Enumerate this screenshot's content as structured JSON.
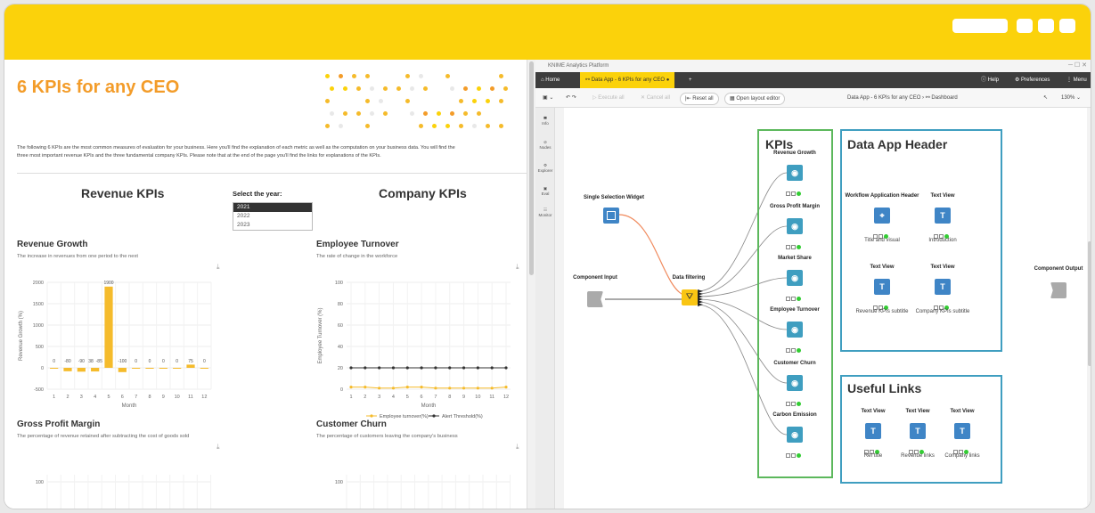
{
  "colors": {
    "accent_yellow": "#fbd20b",
    "title_orange": "#f39c29",
    "bar_yellow": "#f5bb2b",
    "line_black": "#333333",
    "green_box": "#5cb85c",
    "blue_box": "#3f9ec0"
  },
  "left": {
    "title": "6 KPIs for any CEO",
    "intro_line1": "The following 6 KPIs are the most common measures of evaluation for your business. Here you'll find the explanation of each metric as well as the computation on your business data. You will find the",
    "intro_line2": "three most important revenue KPIs and the three fundamental company KPIs. Please note that at the end of the page you'll find the links for explanations of the KPIs.",
    "revenue_heading": "Revenue KPIs",
    "company_heading": "Company KPIs",
    "year_label": "Select the year:",
    "years": [
      "2021",
      "2022",
      "2023"
    ],
    "charts": {
      "rev_growth": {
        "title": "Revenue Growth",
        "desc": "The increase in revenues from one period to the next"
      },
      "emp_turnover": {
        "title": "Employee Turnover",
        "desc": "The rate of change in the workforce"
      },
      "gross_margin": {
        "title": "Gross Profit Margin",
        "desc": "The percentage of revenue retained after subtracting the cost of goods sold"
      },
      "cust_churn": {
        "title": "Customer Churn",
        "desc": "The percentage of customers leaving the company's business"
      }
    }
  },
  "chart_data": [
    {
      "type": "bar",
      "title": "Revenue Growth",
      "xlabel": "Month",
      "ylabel": "Revenue Growth (%)",
      "categories": [
        "1",
        "2",
        "3",
        "4",
        "5",
        "6",
        "7",
        "8",
        "9",
        "10",
        "11",
        "12"
      ],
      "values": [
        0,
        -80,
        -90,
        -85,
        1900,
        -100,
        0,
        0,
        0,
        0,
        75,
        0
      ],
      "data_labels": [
        "0",
        "-80",
        "-90",
        "38",
        "-85",
        "1900",
        "-100",
        "0",
        "0",
        "0",
        "0",
        "75",
        "0"
      ],
      "ylim": [
        -500,
        2000
      ],
      "yticks": [
        "2000",
        "1500",
        "1000",
        "500",
        "0",
        "-500"
      ]
    },
    {
      "type": "line",
      "title": "Employee Turnover",
      "xlabel": "Month",
      "ylabel": "Employee Turnover (%)",
      "x": [
        "1",
        "2",
        "3",
        "4",
        "5",
        "6",
        "7",
        "8",
        "9",
        "10",
        "11",
        "12"
      ],
      "series": [
        {
          "name": "Employee turnover(%)",
          "values": [
            2,
            2,
            1,
            1,
            2,
            2,
            1,
            1,
            1,
            1,
            1,
            2
          ]
        },
        {
          "name": "Alert Threshold(%)",
          "values": [
            20,
            20,
            20,
            20,
            20,
            20,
            20,
            20,
            20,
            20,
            20,
            20
          ]
        }
      ],
      "ylim": [
        0,
        100
      ],
      "yticks": [
        "100",
        "80",
        "60",
        "40",
        "20",
        "0"
      ]
    },
    {
      "type": "bar",
      "title": "Gross Profit Margin",
      "yticks": [
        "100"
      ]
    },
    {
      "type": "line",
      "title": "Customer Churn",
      "yticks": [
        "100"
      ]
    }
  ],
  "right": {
    "window_title": "KNIME Analytics Platform",
    "tabs": {
      "home": "Home",
      "active": "Data App - 6 KPIs for any CEO",
      "help": "Help",
      "preferences": "Preferences",
      "menu": "Menu"
    },
    "toolbar": {
      "execute_all": "Execute all",
      "cancel_all": "Cancel all",
      "reset_all": "Reset all",
      "open_layout": "Open layout editor",
      "breadcrumb_1": "Data App - 6 KPIs for any CEO",
      "breadcrumb_2": "Dashboard",
      "zoom": "130%"
    },
    "sidebar": [
      "Info",
      "Nodes",
      "Explorer",
      "Eval",
      "Monitor"
    ],
    "nodes": {
      "single_selection": "Single Selection Widget",
      "component_input": "Component Input",
      "data_filtering": "Data filtering",
      "component_output": "Component Output",
      "kpis": [
        "Revenue Growth",
        "Gross Profit Margin",
        "Market Share",
        "Employee Turnover",
        "Customer Churn",
        "Carbon Emission"
      ],
      "header_nodes": [
        {
          "label": "Workflow Application Header",
          "sub": "Title and visual"
        },
        {
          "label": "Text View",
          "sub": "Introduction"
        },
        {
          "label": "Text View",
          "sub": "Revenue KPIs subtitle"
        },
        {
          "label": "Text View",
          "sub": "Company KPIs subtitle"
        }
      ],
      "link_nodes": [
        {
          "label": "Text View",
          "sub": "Ref title"
        },
        {
          "label": "Text View",
          "sub": "Revenue links"
        },
        {
          "label": "Text View",
          "sub": "Company links"
        }
      ]
    },
    "annotations": {
      "kpis": "KPIs",
      "header": "Data App Header",
      "links": "Useful Links"
    }
  }
}
